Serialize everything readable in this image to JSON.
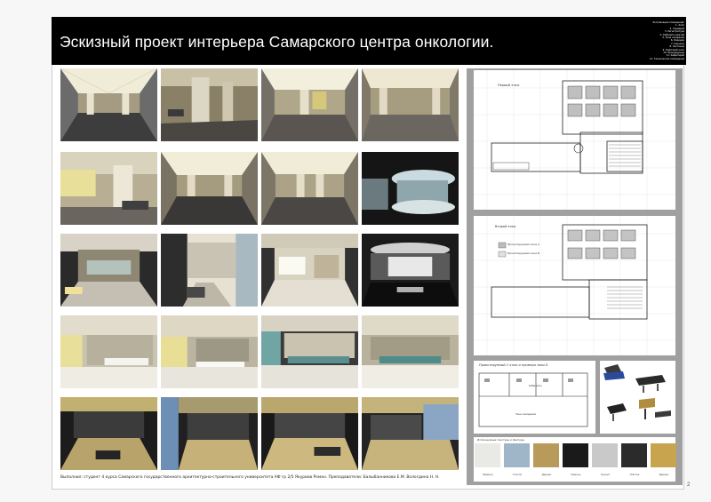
{
  "header": {
    "title": "Эскизный проект интерьера Самарского центра онкологии.",
    "notes": [
      "Экспликация помещений:",
      "1. Холл",
      "2. Гардероб",
      "3. Регистратура",
      "4. Кабинеты врачей",
      "5. Зона ожидания",
      "6. Коридор",
      "7. Санузлы",
      "8. Лестница",
      "9. Лифтовой холл",
      "10. Процедурные",
      "11. Кафетерий",
      "12. Технические помещения"
    ]
  },
  "panels": {
    "plan1_label": "Первый этаж",
    "plan2_label": "Второй этаж",
    "legend_1": "Проектируемая зона А",
    "legend_2": "Проектируемая зона Б",
    "zone_plan_label": "Проектируемый 2 этаж и примера зоны Б",
    "zone_label_a": "Зона ожидания",
    "zone_label_b": "Кабинеты",
    "materials_label": "Используемые текстуры и фактуры"
  },
  "materials": [
    {
      "name": "Мрамор",
      "color": "#e9e9e6"
    },
    {
      "name": "Стекло",
      "color": "#9fb6c8"
    },
    {
      "name": "Дерево",
      "color": "#b89a5a"
    },
    {
      "name": "Камень",
      "color": "#1a1a1a"
    },
    {
      "name": "Гранит",
      "color": "#c9c9c9"
    },
    {
      "name": "Плитка",
      "color": "#2b2b2b"
    },
    {
      "name": "Бетон",
      "color": "#9a9a9a"
    },
    {
      "name": "Дерево",
      "color": "#c9a44e"
    }
  ],
  "footer": {
    "text": "Выполнил: студент 4 курса Самарского государственного архитектурно-строительного университета АФ гр 2/5 Якуриов Роман. Преподаватели: Балыбанникова Е.М. Вологдина Н. Н.",
    "page_number": "2"
  },
  "colors": {
    "background": "#f7f7f7",
    "title_bar": "#000000",
    "side_panel": "#a0a0a0"
  }
}
